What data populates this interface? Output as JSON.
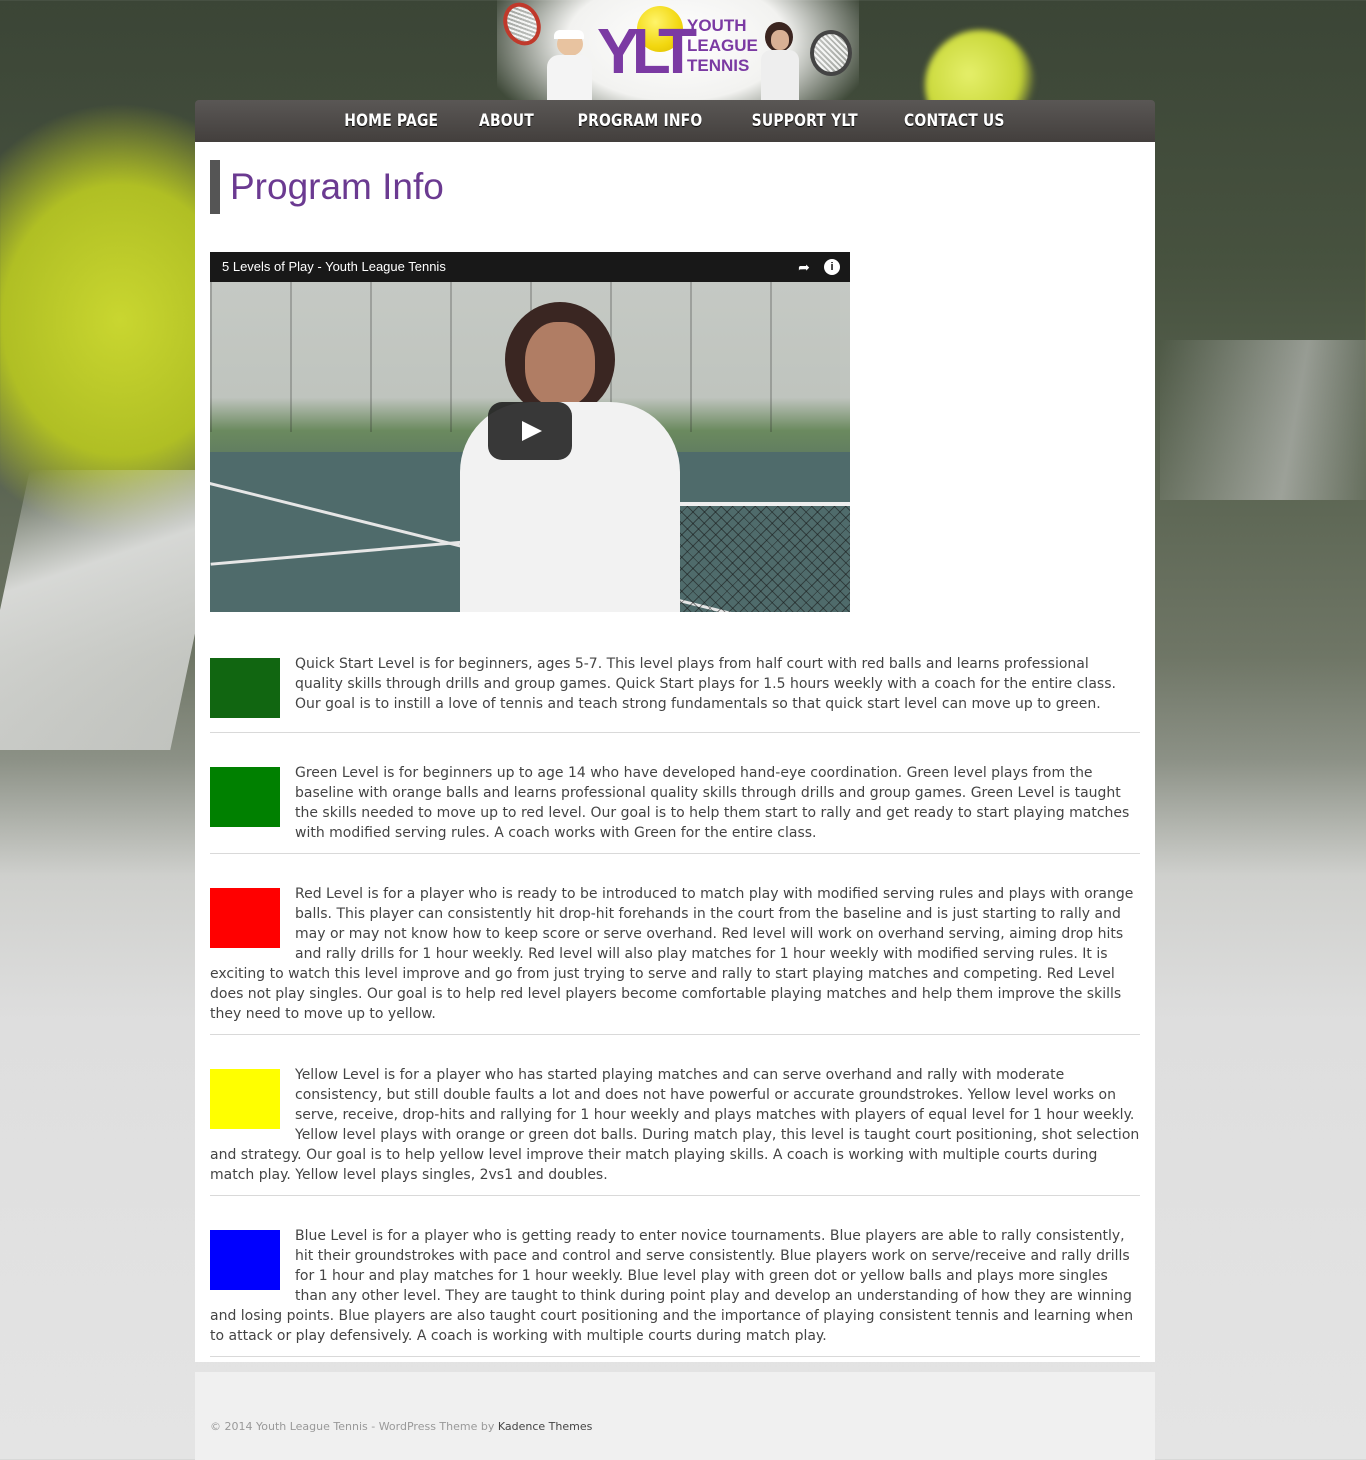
{
  "header": {
    "logo_letters": "YLT",
    "logo_text_lines": [
      "YOUTH",
      "LEAGUE",
      "TENNIS"
    ]
  },
  "nav": {
    "items": [
      "HOME PAGE",
      "ABOUT",
      "PROGRAM INFO",
      "SUPPORT YLT",
      "CONTACT US"
    ]
  },
  "page": {
    "title": "Program Info"
  },
  "video": {
    "title": "5 Levels of Play - Youth League Tennis",
    "icons": [
      "share-icon",
      "info-icon",
      "play-icon"
    ]
  },
  "levels": [
    {
      "color": "#116611",
      "text": "Quick Start Level is for beginners, ages 5-7. This level plays from half court with red balls and learns professional quality skills through drills and group games. Quick Start plays for 1.5 hours weekly with a coach for the entire class. Our goal is to instill a love of tennis and teach strong fundamentals so that quick start level can move up to green."
    },
    {
      "color": "#008000",
      "text": "Green Level is for beginners up to age 14 who have developed hand-eye coordination. Green level plays from the baseline with orange balls and learns professional quality skills through drills and group games. Green Level is taught the skills needed to move up to red level. Our goal is to help them start to rally and get ready to start playing matches with modified serving rules. A coach works with Green for the entire class."
    },
    {
      "color": "#ff0000",
      "text": "Red Level is for a player who is ready to be introduced to match play with modified serving rules and plays with orange balls. This player can consistently hit drop-hit forehands in the court from the baseline and is just starting to rally and may or may not know how to keep score or serve overhand. Red level will work on overhand serving, aiming drop hits and rally drills for 1 hour weekly. Red level will also play matches for 1 hour weekly with modified serving rules. It is exciting to watch this level improve and go from just trying to serve and rally to start playing matches and competing. Red Level does not play singles. Our goal is to help red level players become comfortable playing matches and help them improve the skills they need to move up to yellow."
    },
    {
      "color": "#ffff00",
      "text": "Yellow Level is for a player who has started playing matches and can serve overhand and rally with moderate consistency, but still double faults a lot and does not have powerful or accurate groundstrokes. Yellow level works on serve, receive, drop-hits and rallying for 1 hour weekly and plays matches with players of equal level for 1 hour weekly. Yellow level plays with orange or green dot balls. During match play, this level is taught court positioning, shot selection and strategy. Our goal is to help yellow level improve their match playing skills. A coach is working with multiple courts during match play. Yellow level plays singles, 2vs1 and doubles."
    },
    {
      "color": "#0000ff",
      "text": "Blue Level is for a player who is getting ready to enter novice tournaments. Blue players are able to rally consistently, hit their groundstrokes with pace and control and serve consistently. Blue players work on serve/receive and rally drills for 1 hour and play matches for 1 hour weekly. Blue level play with green dot or yellow balls and plays more singles than any other level. They are taught to think during point play and develop an understanding of how they are winning and losing points. Blue players are also taught court positioning and the importance of playing consistent tennis and learning when to attack or play defensively. A coach is working with multiple courts during match play."
    }
  ],
  "footer": {
    "text": "© 2014 Youth League Tennis - WordPress Theme by",
    "link": "Kadence Themes"
  }
}
